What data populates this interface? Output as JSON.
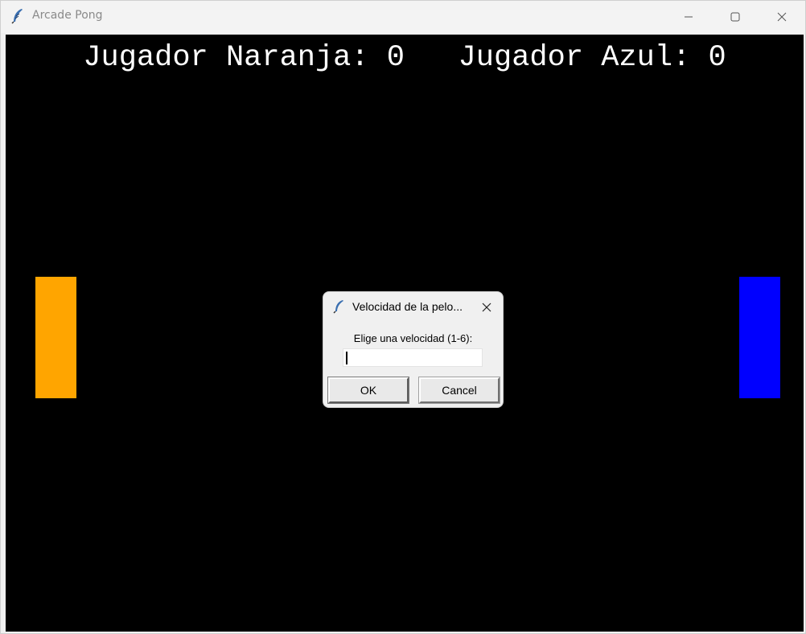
{
  "window": {
    "title": "Arcade Pong",
    "icon": "feather-icon"
  },
  "scoreboard": {
    "text": "Jugador Naranja: 0   Jugador Azul: 0",
    "orange_label": "Jugador Naranja",
    "orange_score": 0,
    "blue_label": "Jugador Azul",
    "blue_score": 0
  },
  "paddles": {
    "left_color": "#ffa500",
    "right_color": "#0000ff"
  },
  "canvas_background": "#000000",
  "dialog": {
    "title": "Velocidad de la pelo...",
    "prompt": "Elige una velocidad (1-6):",
    "input_value": "",
    "ok_label": "OK",
    "cancel_label": "Cancel"
  }
}
